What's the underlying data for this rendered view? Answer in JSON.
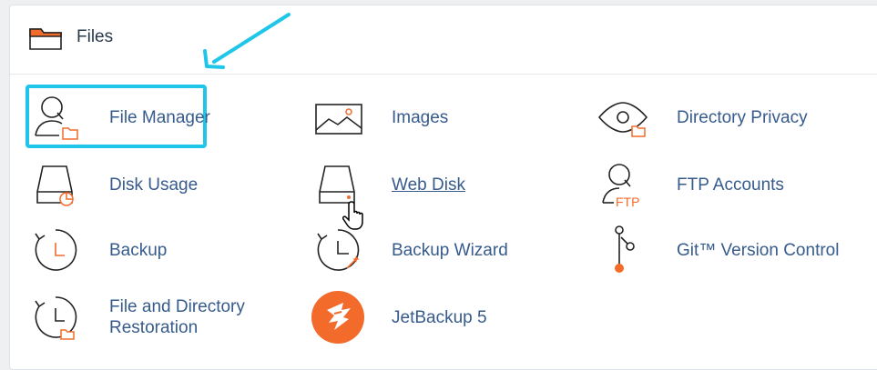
{
  "section": {
    "title": "Files",
    "icon": "folder-icon"
  },
  "items": [
    {
      "label": "File Manager",
      "icon": "file-manager-icon"
    },
    {
      "label": "Images",
      "icon": "images-icon"
    },
    {
      "label": "Directory Privacy",
      "icon": "directory-privacy-icon"
    },
    {
      "label": "Disk Usage",
      "icon": "disk-usage-icon"
    },
    {
      "label": "Web Disk",
      "icon": "web-disk-icon"
    },
    {
      "label": "FTP Accounts",
      "icon": "ftp-accounts-icon",
      "icon_text": "FTP"
    },
    {
      "label": "Backup",
      "icon": "backup-icon"
    },
    {
      "label": "Backup Wizard",
      "icon": "backup-wizard-icon"
    },
    {
      "label": "Git™ Version Control",
      "icon": "git-icon"
    },
    {
      "label": "File and Directory Restoration",
      "icon": "restoration-icon"
    },
    {
      "label": "JetBackup 5",
      "icon": "jetbackup-icon"
    }
  ],
  "colors": {
    "link": "#365b8c",
    "accent_orange": "#f26b2a",
    "highlight_cyan": "#1fc6ea",
    "icon_stroke": "#222222"
  }
}
